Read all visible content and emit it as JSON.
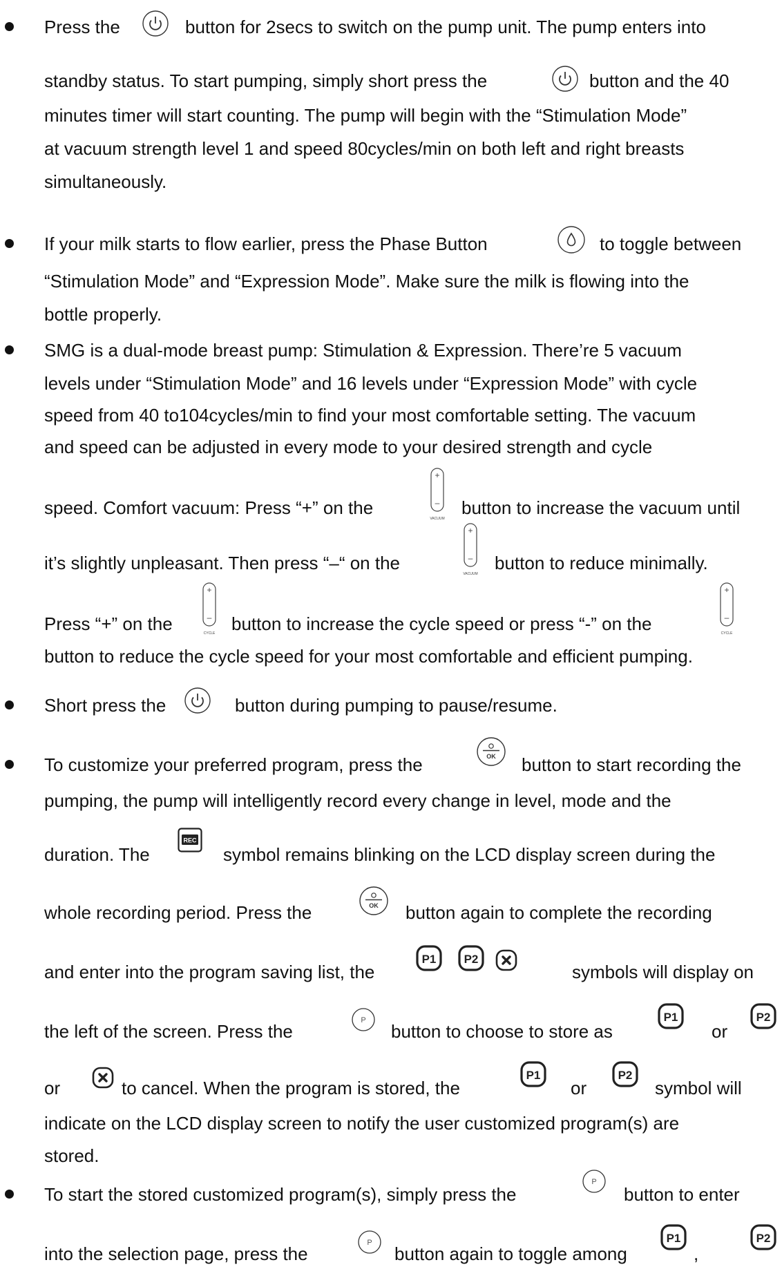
{
  "icons": {
    "power": "power-icon",
    "phase": "drop-icon",
    "vacuum": "vacuum-adjust-icon",
    "cycle": "cycle-adjust-icon",
    "ok": "ok-record-icon",
    "rec": "rec-symbol-icon",
    "p1": "p1-symbol-icon",
    "p2": "p2-symbol-icon",
    "cancel": "cancel-x-icon",
    "program": "program-button-icon"
  },
  "icon_labels": {
    "vacuum": "VACUUM",
    "cycle": "CYCLE",
    "ok": "OK",
    "rec": "REC",
    "p1": "P1",
    "p2": "P2",
    "program": "P",
    "plus": "+",
    "minus": "–"
  },
  "bullets": [
    {
      "lines": [
        {
          "a": "Press the",
          "b": "button for 2secs to switch on the pump unit. The pump enters into"
        },
        {
          "a": "standby status. To start pumping, simply short press the",
          "b": "button and the 40"
        },
        {
          "a": "minutes timer will start counting. The pump will begin with the “Stimulation Mode”"
        },
        {
          "a": "at vacuum strength level 1 and speed 80cycles/min on both left and right breasts"
        },
        {
          "a": "simultaneously."
        }
      ]
    },
    {
      "lines": [
        {
          "a": "If your milk starts to flow earlier, press the Phase Button",
          "b": "to toggle between"
        },
        {
          "a": "“Stimulation Mode” and “Expression Mode”. Make sure the milk is flowing into the"
        },
        {
          "a": "bottle properly."
        }
      ]
    },
    {
      "lines": [
        {
          "a": "SMG is a dual-mode breast pump: Stimulation & Expression. There’re 5 vacuum"
        },
        {
          "a": "levels under “Stimulation Mode” and 16 levels under “Expression Mode” with cycle"
        },
        {
          "a": "speed from 40 to104cycles/min to find your most comfortable setting. The vacuum"
        },
        {
          "a": "and speed can be adjusted in every mode to your desired strength and cycle"
        },
        {
          "a": "speed. Comfort vacuum: Press “+” on the",
          "b": "button to increase the vacuum until"
        },
        {
          "a": "it’s slightly unpleasant. Then press “–“ on the",
          "b": "button to reduce minimally."
        },
        {
          "a": "Press “+” on the",
          "b": "button to increase the cycle speed or press “-” on the"
        },
        {
          "a": "button to reduce the cycle speed for your most comfortable and efficient pumping."
        }
      ]
    },
    {
      "lines": [
        {
          "a": "Short press the",
          "b": "button during pumping to pause/resume."
        }
      ]
    },
    {
      "lines": [
        {
          "a": "To customize your preferred program, press the",
          "b": "button to start recording the"
        },
        {
          "a": "pumping, the pump will intelligently record every change in level, mode and the"
        },
        {
          "a": "duration. The",
          "b": "symbol remains blinking on the LCD display screen during the"
        },
        {
          "a": "whole recording period. Press the",
          "b": "button again to complete the recording"
        },
        {
          "a": "and enter into the program saving list, the",
          "b": "symbols will display on"
        },
        {
          "a": "the left of the screen. Press the",
          "b": "button to choose to store as",
          "c": "or"
        },
        {
          "a": "or",
          "b": "to cancel. When the program is stored, the",
          "c": "or",
          "d": "symbol will"
        },
        {
          "a": "indicate on the LCD display screen to notify the user customized program(s) are"
        },
        {
          "a": "stored."
        }
      ]
    },
    {
      "lines": [
        {
          "a": "To start the stored customized program(s), simply press the",
          "b": "button to enter"
        },
        {
          "a": "into the selection page, press the",
          "b": "button again to toggle among",
          "c": ","
        }
      ]
    }
  ]
}
